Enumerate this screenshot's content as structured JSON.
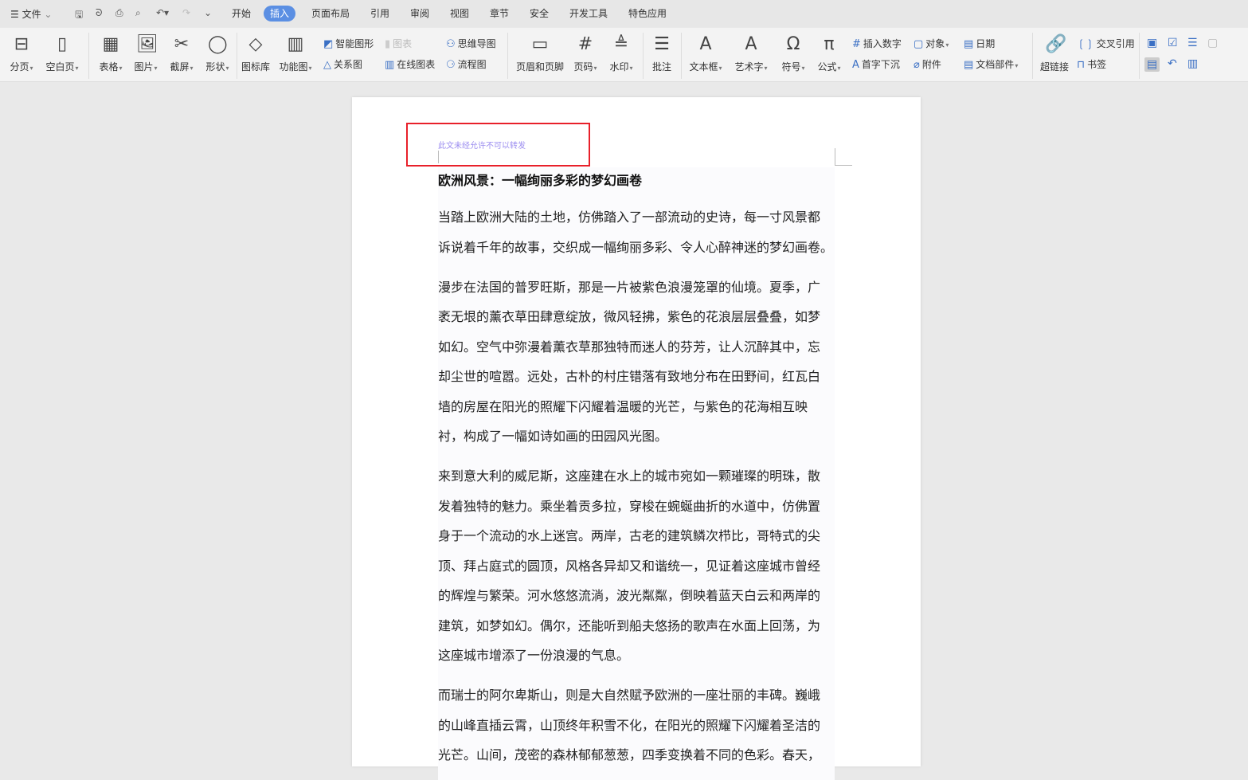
{
  "menubar": {
    "file": "文件",
    "quick_icons": [
      "save-icon",
      "undo-format-icon",
      "print-icon",
      "print-preview-icon",
      "undo-icon",
      "redo-icon",
      "more-icon"
    ]
  },
  "tabs": [
    {
      "label": "开始"
    },
    {
      "label": "插入",
      "active": true
    },
    {
      "label": "页面布局"
    },
    {
      "label": "引用"
    },
    {
      "label": "审阅"
    },
    {
      "label": "视图"
    },
    {
      "label": "章节"
    },
    {
      "label": "安全"
    },
    {
      "label": "开发工具"
    },
    {
      "label": "特色应用"
    }
  ],
  "ribbon": {
    "big": [
      {
        "label": "分页",
        "icon": "⊟",
        "caret": true,
        "name": "page-break"
      },
      {
        "label": "空白页",
        "icon": "▯",
        "caret": true,
        "name": "blank-page"
      },
      {
        "label": "表格",
        "icon": "▦",
        "caret": true,
        "name": "table"
      },
      {
        "label": "图片",
        "icon": "🖼",
        "caret": true,
        "name": "picture"
      },
      {
        "label": "截屏",
        "icon": "✂",
        "caret": true,
        "name": "screenshot"
      },
      {
        "label": "形状",
        "icon": "◯",
        "caret": true,
        "name": "shapes"
      },
      {
        "label": "图标库",
        "icon": "◇",
        "caret": false,
        "name": "icon-library"
      },
      {
        "label": "功能图",
        "icon": "▥",
        "caret": true,
        "name": "function-chart"
      },
      {
        "label": "页眉和页脚",
        "icon": "▭",
        "caret": false,
        "name": "header-footer"
      },
      {
        "label": "页码",
        "icon": "#",
        "caret": true,
        "name": "page-number"
      },
      {
        "label": "水印",
        "icon": "≜",
        "caret": true,
        "name": "watermark"
      },
      {
        "label": "批注",
        "icon": "☰",
        "caret": false,
        "name": "comment"
      },
      {
        "label": "文本框",
        "icon": "A",
        "caret": true,
        "name": "text-box"
      },
      {
        "label": "艺术字",
        "icon": "A",
        "caret": true,
        "name": "word-art"
      },
      {
        "label": "符号",
        "icon": "Ω",
        "caret": true,
        "name": "symbol"
      },
      {
        "label": "公式",
        "icon": "π",
        "caret": true,
        "name": "formula"
      },
      {
        "label": "超链接",
        "icon": "🔗",
        "caret": false,
        "name": "hyperlink"
      }
    ],
    "small": [
      {
        "label": "智能图形",
        "icon": "◩",
        "name": "smart-art"
      },
      {
        "label": "关系图",
        "icon": "△",
        "name": "relation-chart"
      },
      {
        "label": "图表",
        "icon": "▮",
        "name": "chart",
        "disabled": true
      },
      {
        "label": "在线图表",
        "icon": "▥",
        "name": "online-chart"
      },
      {
        "label": "思维导图",
        "icon": "⚇",
        "name": "mind-map"
      },
      {
        "label": "流程图",
        "icon": "⚆",
        "name": "flowchart"
      },
      {
        "label": "插入数字",
        "icon": "#",
        "name": "insert-number"
      },
      {
        "label": "首字下沉",
        "icon": "A",
        "name": "drop-cap"
      },
      {
        "label": "对象",
        "icon": "▢",
        "name": "object",
        "caret": true
      },
      {
        "label": "附件",
        "icon": "⌀",
        "name": "attachment"
      },
      {
        "label": "日期",
        "icon": "▤",
        "name": "date"
      },
      {
        "label": "文档部件",
        "icon": "▤",
        "name": "doc-parts",
        "caret": true
      },
      {
        "label": "交叉引用",
        "icon": "❲❳",
        "name": "cross-reference"
      },
      {
        "label": "书签",
        "icon": "⊓",
        "name": "bookmark"
      }
    ]
  },
  "document": {
    "header_text": "此文未经允许不可以转发",
    "title": "欧洲风景：一幅绚丽多彩的梦幻画卷",
    "paragraphs": [
      [
        "当踏上欧洲大陆的土地，仿佛踏入了一部流动的史诗，每一寸风景都",
        "诉说着千年的故事，交织成一幅绚丽多彩、令人心醉神迷的梦幻画卷。"
      ],
      [
        "漫步在法国的普罗旺斯，那是一片被紫色浪漫笼罩的仙境。夏季，广",
        "袤无垠的薰衣草田肆意绽放，微风轻拂，紫色的花浪层层叠叠，如梦",
        "如幻。空气中弥漫着薰衣草那独特而迷人的芬芳，让人沉醉其中，忘",
        "却尘世的喧嚣。远处，古朴的村庄错落有致地分布在田野间，红瓦白",
        "墙的房屋在阳光的照耀下闪耀着温暖的光芒，与紫色的花海相互映",
        "衬，构成了一幅如诗如画的田园风光图。"
      ],
      [
        "来到意大利的威尼斯，这座建在水上的城市宛如一颗璀璨的明珠，散",
        "发着独特的魅力。乘坐着贡多拉，穿梭在蜿蜒曲折的水道中，仿佛置",
        "身于一个流动的水上迷宫。两岸，古老的建筑鳞次栉比，哥特式的尖",
        "顶、拜占庭式的圆顶，风格各异却又和谐统一，见证着这座城市曾经",
        "的辉煌与繁荣。河水悠悠流淌，波光粼粼，倒映着蓝天白云和两岸的",
        "建筑，如梦如幻。偶尔，还能听到船夫悠扬的歌声在水面上回荡，为",
        "这座城市增添了一份浪漫的气息。"
      ],
      [
        "而瑞士的阿尔卑斯山，则是大自然赋予欧洲的一座壮丽的丰碑。巍峨",
        "的山峰直插云霄，山顶终年积雪不化，在阳光的照耀下闪耀着圣洁的",
        "光芒。山间，茂密的森林郁郁葱葱，四季变换着不同的色彩。春天，"
      ]
    ]
  },
  "colors": {
    "accent": "#5b8fe3",
    "highlight_box": "#e8202a",
    "header_text": "#9b8cf0"
  }
}
